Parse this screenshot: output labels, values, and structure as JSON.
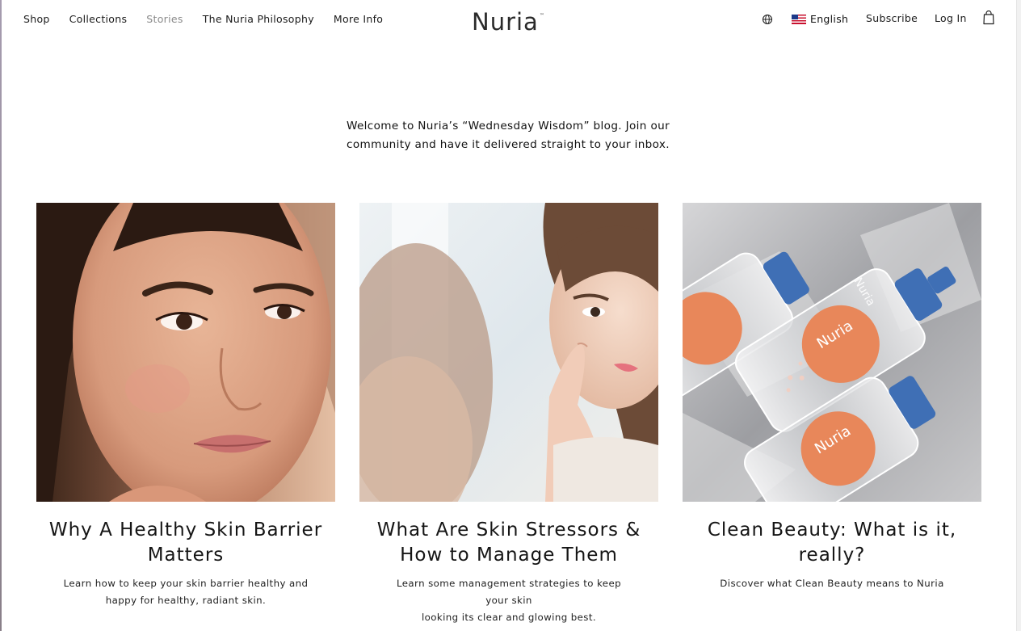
{
  "nav": {
    "items": [
      {
        "label": "Shop"
      },
      {
        "label": "Collections"
      },
      {
        "label": "Stories"
      },
      {
        "label": "The Nuria Philosophy"
      },
      {
        "label": "More Info"
      }
    ],
    "active": "Stories"
  },
  "brand": {
    "name": "Nuria",
    "tm": "™"
  },
  "header_right": {
    "language": "English",
    "subscribe": "Subscribe",
    "login": "Log In",
    "icons": [
      "globe-icon",
      "us-flag-icon",
      "cart-icon"
    ]
  },
  "intro": {
    "line1": "Welcome to Nuria’s “Wednesday Wisdom” blog. Join our",
    "line2": "community and have it delivered straight to your inbox."
  },
  "articles": [
    {
      "title_line1": "Why A Healthy Skin Barrier",
      "title_line2": "Matters",
      "desc_line1": "Learn how to keep your skin barrier healthy and",
      "desc_line2": "happy for healthy, radiant skin."
    },
    {
      "title_line1": "What Are Skin Stressors &",
      "title_line2": "How to Manage Them",
      "desc_line1": "Learn some management strategies to keep your skin",
      "desc_line2": "looking its clear and glowing best."
    },
    {
      "title_line1": "Clean Beauty: What is it,",
      "title_line2": "really?",
      "desc_line1": "Discover what Clean Beauty means to Nuria",
      "desc_line2": ""
    }
  ],
  "bottle_labels": [
    "Nuria",
    "Nuria",
    "Nuria"
  ],
  "colors": {
    "accent_orange": "#e8875a",
    "cap_blue": "#3f6fb5",
    "text": "#111111",
    "muted_nav": "#8a8a8a"
  }
}
